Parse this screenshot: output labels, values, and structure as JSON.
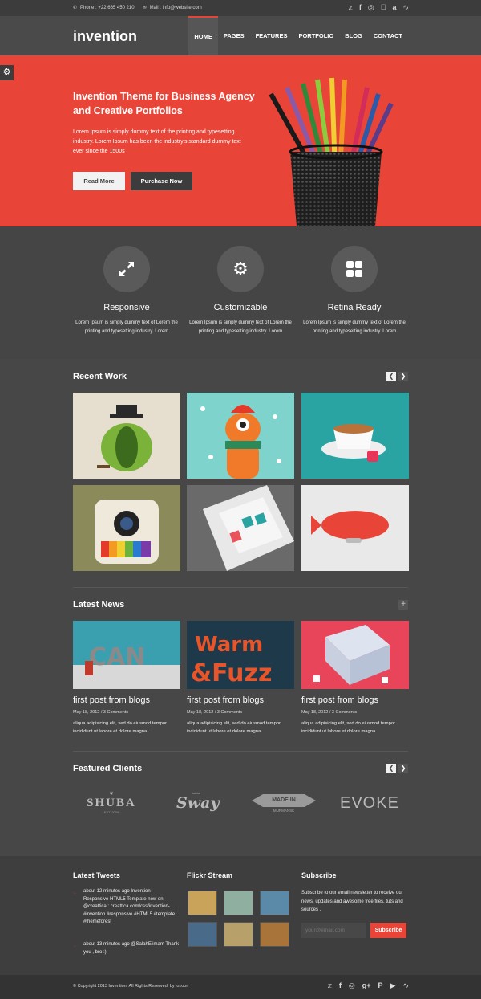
{
  "topbar": {
    "phone": "Phone : +22 665 450 210",
    "mail": "Mail : info@website.com",
    "social_icons": [
      "twitter-icon",
      "facebook-icon",
      "dribbble-icon",
      "apple-icon",
      "amazon-icon",
      "rss-icon"
    ]
  },
  "header": {
    "logo": "invention",
    "nav": [
      "HOME",
      "PAGES",
      "FEATURES",
      "PORTFOLIO",
      "BLOG",
      "CONTACT"
    ],
    "active_nav": "HOME"
  },
  "hero": {
    "title": "Invention Theme for Business Agency and Creative Portfolios",
    "text": "Lorem Ipsum is simply dummy text of the printing and typesetting industry. Lorem Ipsum has been the industry's standard dummy text ever since the 1500s",
    "btn_primary": "Read More",
    "btn_secondary": "Purchase Now"
  },
  "features": [
    {
      "icon": "expand-arrows-icon",
      "title": "Responsive",
      "text": "Lorem Ipsum is simply dummy text of Lorem the printing and typesetting industry. Lorem"
    },
    {
      "icon": "gears-icon",
      "title": "Customizable",
      "text": "Lorem Ipsum is simply dummy text of Lorem the printing and typesetting industry. Lorem"
    },
    {
      "icon": "grid-icon",
      "title": "Retina Ready",
      "text": "Lorem Ipsum is simply dummy text of Lorem the printing and typesetting industry. Lorem"
    }
  ],
  "recent_work": {
    "title": "Recent Work"
  },
  "latest_news": {
    "title": "Latest News",
    "posts": [
      {
        "title": "first post from blogs",
        "meta": "May 18, 2012 / 3 Comments",
        "text": "aliqua.adipisicing elit, sed do eiusmod tempor incididunt ut labore et dolore magna.."
      },
      {
        "title": "first post from blogs",
        "meta": "May 18, 2012 / 3 Comments",
        "text": "aliqua.adipisicing elit, sed do eiusmod tempor incididunt ut labore et dolore magna.."
      },
      {
        "title": "first post from blogs",
        "meta": "May 18, 2012 / 3 Comments",
        "text": "aliqua.adipisicing elit, sed do eiusmod tempor incididunt ut labore et dolore magna.."
      }
    ]
  },
  "clients": {
    "title": "Featured Clients",
    "logos": [
      "SHUBA",
      "Sway",
      "MADE IN",
      "MURMANSK",
      "EVOKE"
    ],
    "shuba_sub": "· EST. 2006 ·",
    "sway_small": "social"
  },
  "footer": {
    "tweets_title": "Latest Tweets",
    "tweets": [
      "about 12 minutes ago Invention - Responsive HTML5 Template now on @creattica : creattica.com/css/invention-... , #invention #responsive #HTML5 #template #themeforest",
      "about 13 minutes ago @SalahElimam Thank you , bro :)"
    ],
    "flickr_title": "Flickr Stream",
    "subscribe_title": "Subscribe",
    "subscribe_text": "Subscribe to our email newsletter to receive our news, updates and awesome free files, tuts and sources .",
    "email_placeholder": "your@email.com",
    "subscribe_button": "Subscribe"
  },
  "bottom": {
    "copyright": "© Copyright 2013 Invention. All Rights Reserved. by jozoor",
    "social_icons": [
      "twitter-icon",
      "facebook-icon",
      "dribbble-icon",
      "google-plus-icon",
      "pinterest-icon",
      "youtube-icon",
      "rss-icon"
    ]
  },
  "colors": {
    "accent": "#e84538",
    "dark": "#474747",
    "footer": "#3e3e3e"
  }
}
